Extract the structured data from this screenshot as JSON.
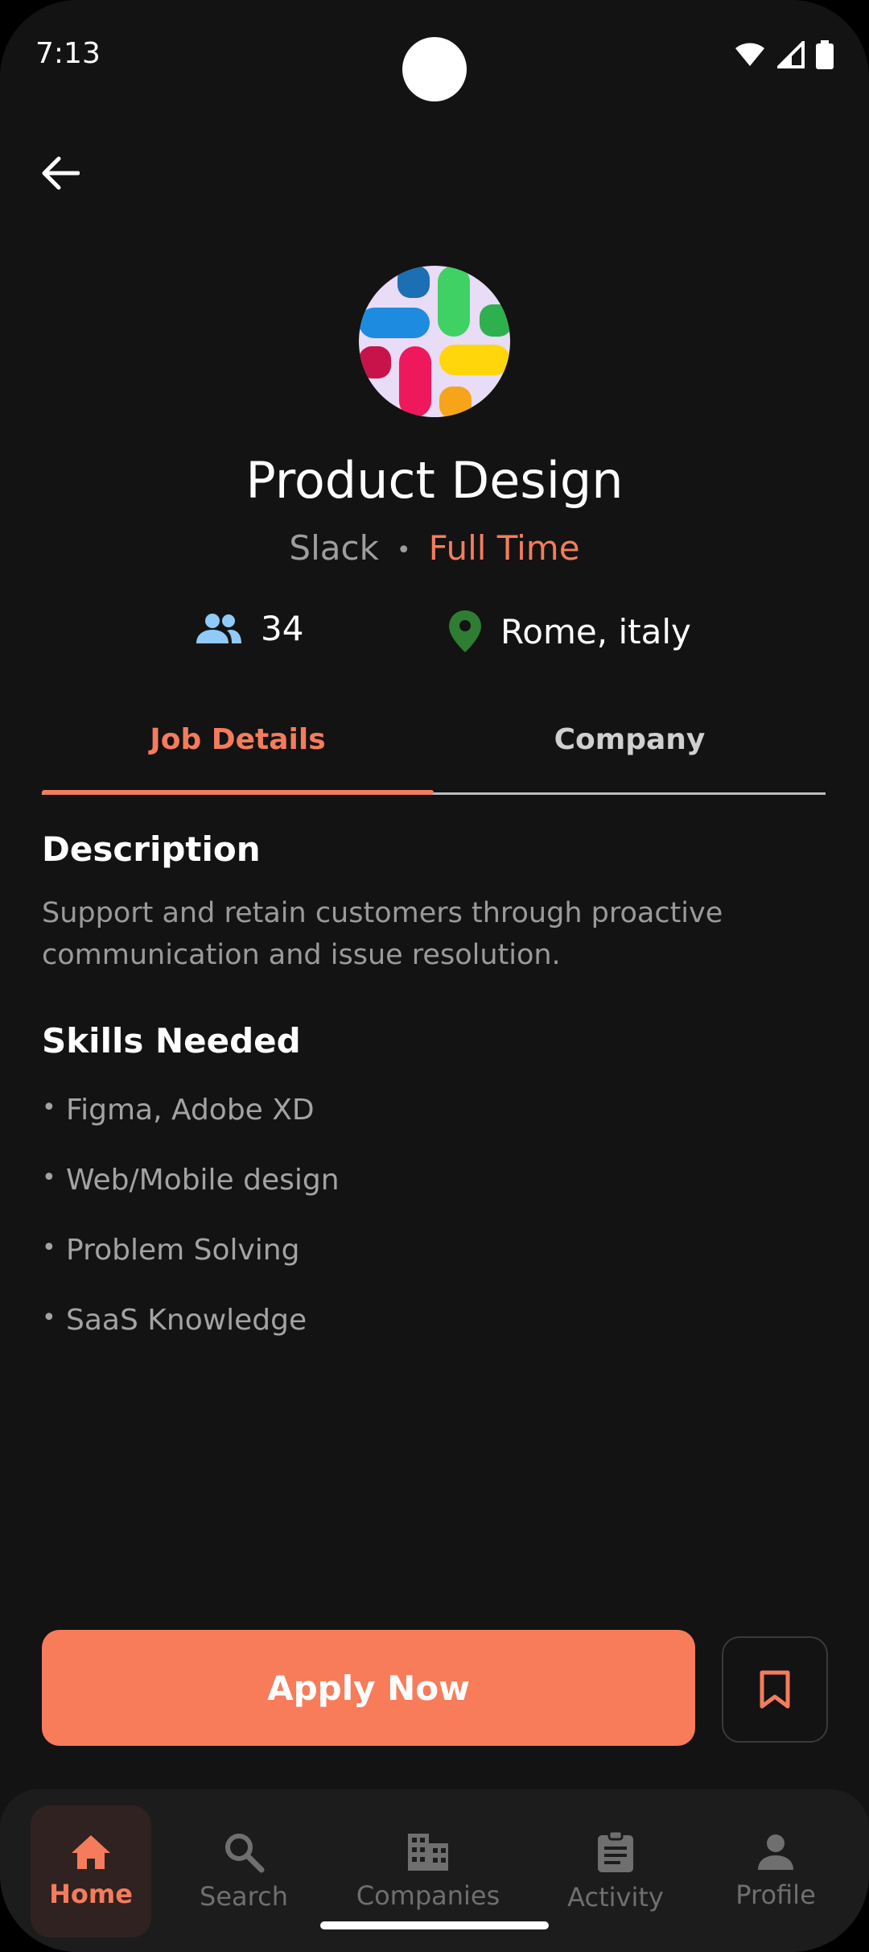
{
  "status_bar": {
    "time": "7:13"
  },
  "job": {
    "title": "Product Design",
    "company": "Slack",
    "separator": "•",
    "employment_type": "Full Time",
    "applicants": "34",
    "location": "Rome, italy"
  },
  "tabs": [
    {
      "label": "Job Details",
      "active": true
    },
    {
      "label": "Company",
      "active": false
    }
  ],
  "description": {
    "heading": "Description",
    "text": "Support and retain customers through proactive communication and issue resolution."
  },
  "skills": {
    "heading": "Skills Needed",
    "bullet": "•",
    "items": [
      "Figma, Adobe XD",
      "Web/Mobile design",
      "Problem Solving",
      "SaaS Knowledge"
    ]
  },
  "actions": {
    "apply_label": "Apply Now",
    "bookmark_icon": "bookmark-icon"
  },
  "bottom_nav": [
    {
      "label": "Home",
      "icon": "home-icon",
      "active": true
    },
    {
      "label": "Search",
      "icon": "search-icon",
      "active": false
    },
    {
      "label": "Companies",
      "icon": "building-icon",
      "active": false
    },
    {
      "label": "Activity",
      "icon": "clipboard-icon",
      "active": false
    },
    {
      "label": "Profile",
      "icon": "person-icon",
      "active": false
    }
  ],
  "colors": {
    "accent": "#f47c5d",
    "background": "#131313",
    "people_icon": "#90caf9",
    "location_icon": "#2e7d32"
  }
}
